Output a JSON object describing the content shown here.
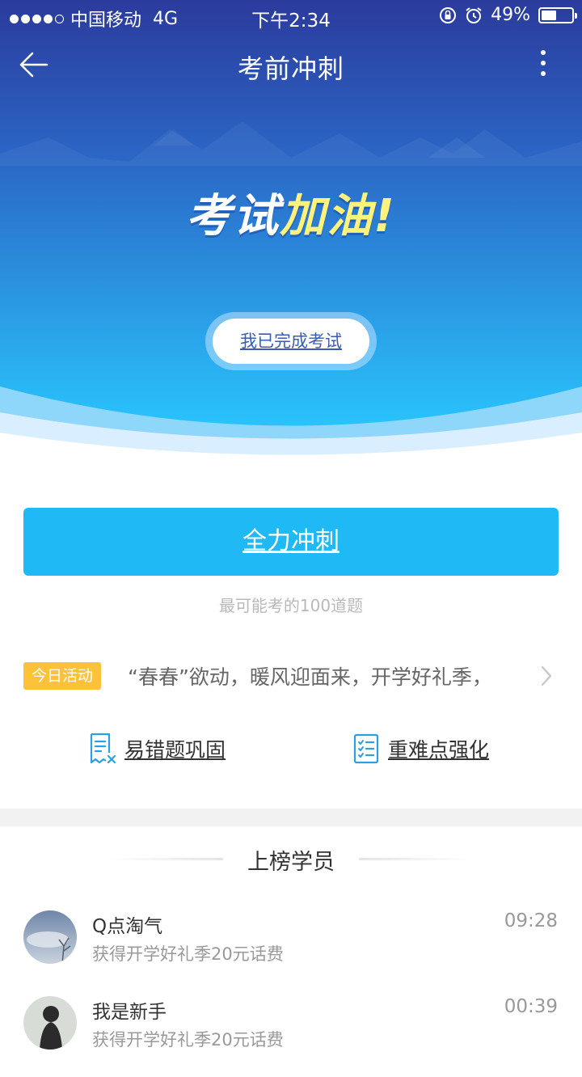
{
  "status_bar": {
    "carrier": "中国移动",
    "network": "4G",
    "time": "下午2:34",
    "battery_percent": "49%",
    "battery_level": 0.49,
    "icons": [
      "signal-dots",
      "orientation-lock-icon",
      "alarm-icon",
      "battery-icon"
    ]
  },
  "nav": {
    "title": "考前冲刺",
    "icons": [
      "back-arrow-icon",
      "more-vertical-icon"
    ]
  },
  "hero": {
    "slogan_white": "考试",
    "slogan_yellow": "加油!",
    "done_button": "我已完成考试"
  },
  "sprint": {
    "button": "全力冲刺",
    "subtitle": "最可能考的100道题"
  },
  "activity": {
    "tag": "今日活动",
    "text": "“春春”欲动，暖风迎面来，开学好礼季，"
  },
  "tools": [
    {
      "label": "易错题巩固",
      "icon": "wrong-questions-icon"
    },
    {
      "label": "重难点强化",
      "icon": "checklist-icon"
    }
  ],
  "ranking": {
    "title": "上榜学员",
    "items": [
      {
        "name": "Q点淘气",
        "desc": "获得开学好礼季20元话费",
        "time": "09:28"
      },
      {
        "name": "我是新手",
        "desc": "获得开学好礼季20元话费",
        "time": "00:39"
      }
    ]
  },
  "colors": {
    "hero_top": "#2a3f9e",
    "hero_bottom": "#29c0fb",
    "accent": "#1fbaf5",
    "tag": "#fdc23a",
    "slogan_yellow": "#fdf27b"
  }
}
